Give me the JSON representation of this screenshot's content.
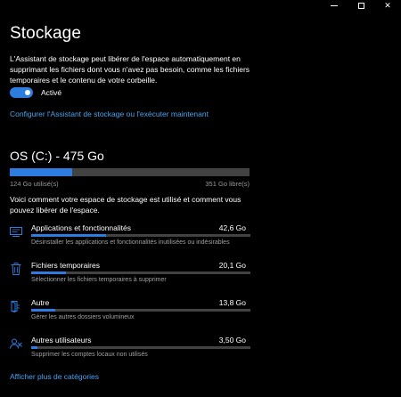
{
  "window": {
    "minimize_glyph": "",
    "maximize_glyph": "",
    "close_glyph": "✕"
  },
  "page": {
    "title": "Stockage"
  },
  "storage_sense": {
    "description": "L'Assistant de stockage peut libérer de l'espace automatiquement en supprimant les fichiers dont vous n'avez pas besoin, comme les fichiers temporaires et le contenu de votre corbeille.",
    "toggle_state": "on",
    "toggle_label": "Activé",
    "configure_link": "Configurer l'Assistant de stockage ou l'exécuter maintenant"
  },
  "drive": {
    "title": "OS (C:) - 475 Go",
    "used_fraction": 0.261,
    "used_label": "124 Go utilisé(s)",
    "free_label": "351 Go libre(s)",
    "intro": "Voici comment votre espace de stockage est utilisé et comment vous pouvez libérer de l'espace."
  },
  "categories": [
    {
      "name": "Applications et fonctionnalités",
      "size": "42,6 Go",
      "fraction": 0.34,
      "description": "Désinstaller les applications et fonctionnalités inutilisées ou indésirables",
      "icon": "apps-icon"
    },
    {
      "name": "Fichiers temporaires",
      "size": "20,1 Go",
      "fraction": 0.16,
      "description": "Sélectionner les fichiers temporaires à supprimer",
      "icon": "trash-icon"
    },
    {
      "name": "Autre",
      "size": "13,8 Go",
      "fraction": 0.11,
      "description": "Gérer les autres dossiers volumineux",
      "icon": "folder-icon"
    },
    {
      "name": "Autres utilisateurs",
      "size": "3,50 Go",
      "fraction": 0.028,
      "description": "Supprimer les comptes locaux non utilisés",
      "icon": "users-icon"
    }
  ],
  "more_link": "Afficher plus de catégories",
  "colors": {
    "accent": "#2d7de0",
    "link": "#4aa3ee",
    "track": "#424242",
    "background": "#000000"
  }
}
